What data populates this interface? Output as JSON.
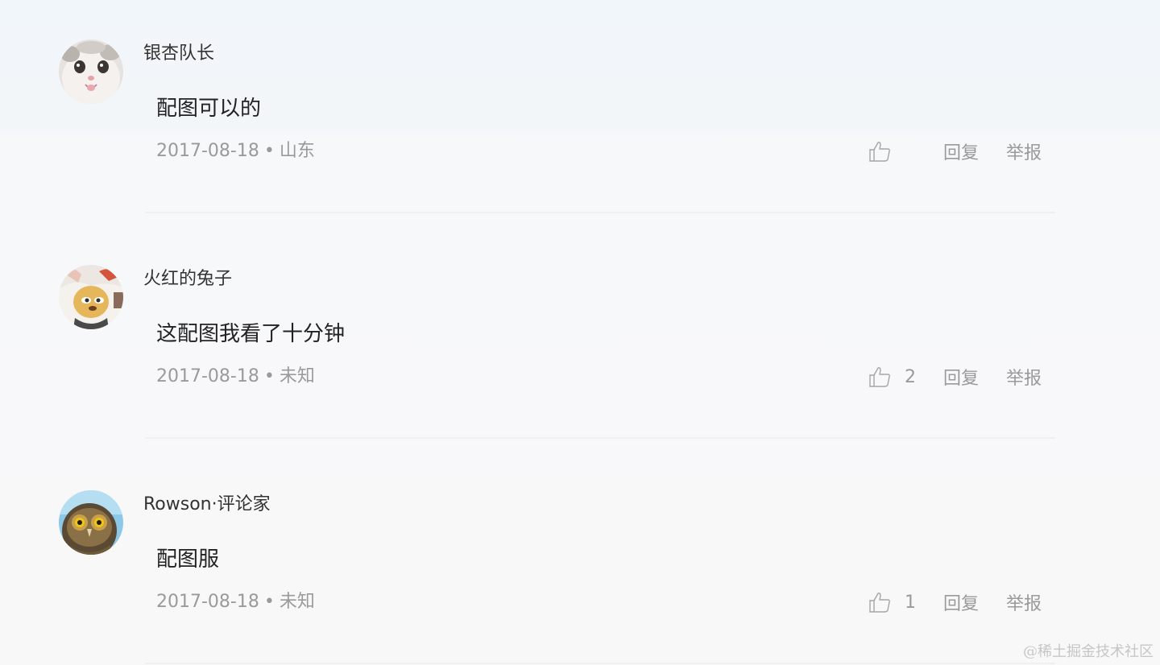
{
  "comments": [
    {
      "username": "银杏队长",
      "content": "配图可以的",
      "date": "2017-08-18",
      "separator": "•",
      "location": "山东",
      "like_count": "",
      "reply_label": "回复",
      "report_label": "举报"
    },
    {
      "username": "火红的兔子",
      "content": "这配图我看了十分钟",
      "date": "2017-08-18",
      "separator": "•",
      "location": "未知",
      "like_count": "2",
      "reply_label": "回复",
      "report_label": "举报"
    },
    {
      "username": "Rowson·评论家",
      "content": "配图服",
      "date": "2017-08-18",
      "separator": "•",
      "location": "未知",
      "like_count": "1",
      "reply_label": "回复",
      "report_label": "举报"
    }
  ],
  "watermark": "@稀土掘金技术社区",
  "colors": {
    "username": "#333333",
    "content": "#222222",
    "meta": "#9a9a9a",
    "divider": "#eeeff1",
    "background": "#f7f8fa"
  },
  "icons": {
    "like": "thumbs-up-icon"
  }
}
